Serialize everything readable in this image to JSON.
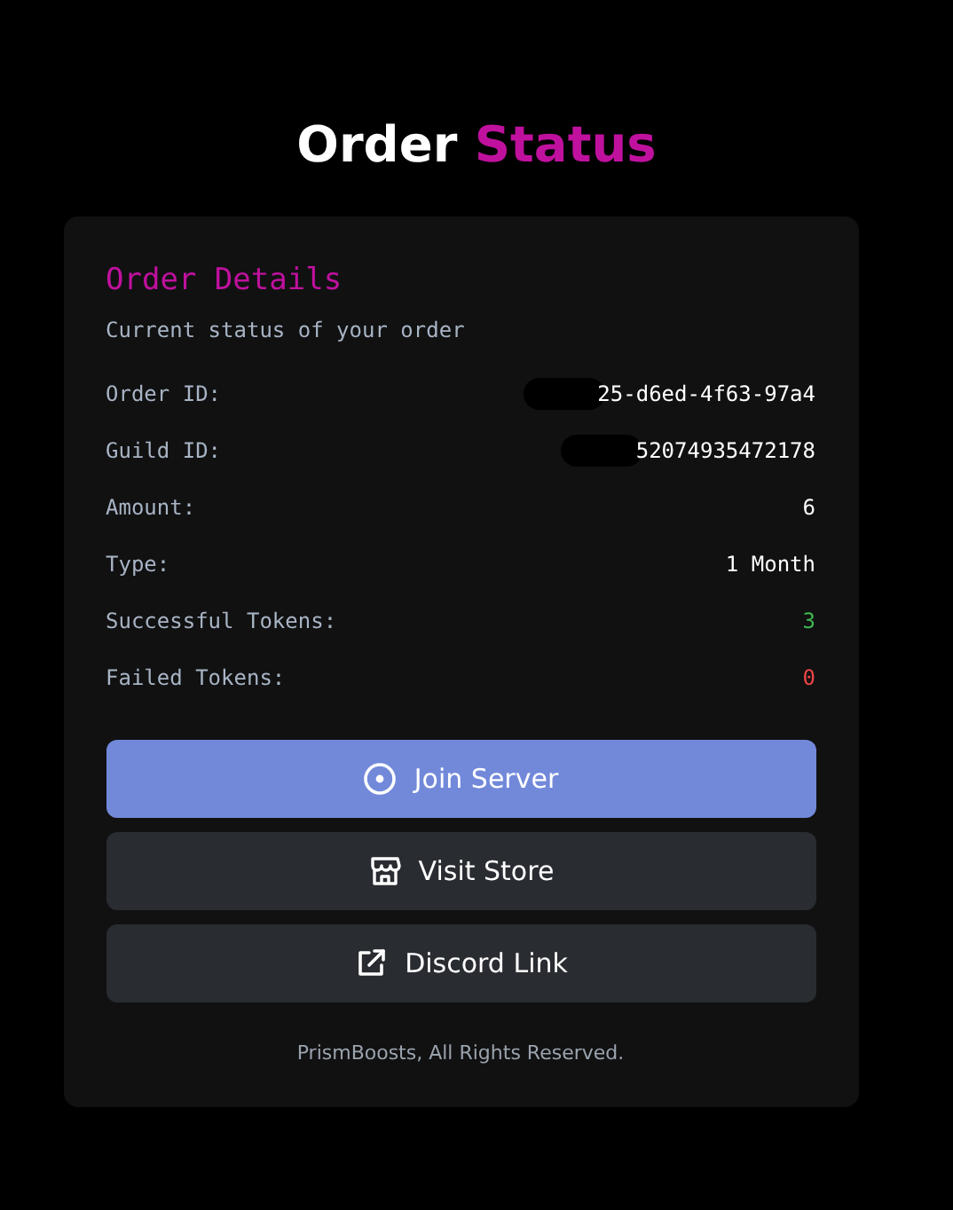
{
  "title": {
    "main": "Order",
    "accent": "Status"
  },
  "card": {
    "heading": "Order Details",
    "subtitle": "Current status of your order",
    "rows": [
      {
        "label": "Order ID:",
        "value": "25-d6ed-4f63-97a4",
        "redacted": true,
        "color": "#ffffff"
      },
      {
        "label": "Guild ID:",
        "value": "52074935472178",
        "redacted": true,
        "color": "#ffffff"
      },
      {
        "label": "Amount:",
        "value": "6",
        "redacted": false,
        "color": "#ffffff"
      },
      {
        "label": "Type:",
        "value": "1 Month",
        "redacted": false,
        "color": "#ffffff"
      },
      {
        "label": "Successful Tokens:",
        "value": "3",
        "redacted": false,
        "color": "#3fb950"
      },
      {
        "label": "Failed Tokens:",
        "value": "0",
        "redacted": false,
        "color": "#f04545"
      }
    ],
    "buttons": [
      {
        "label": "Join Server",
        "kind": "primary"
      },
      {
        "label": "Visit Store",
        "kind": "secondary"
      },
      {
        "label": "Discord Link",
        "kind": "secondary"
      }
    ],
    "footer": "PrismBoosts, All Rights Reserved."
  }
}
